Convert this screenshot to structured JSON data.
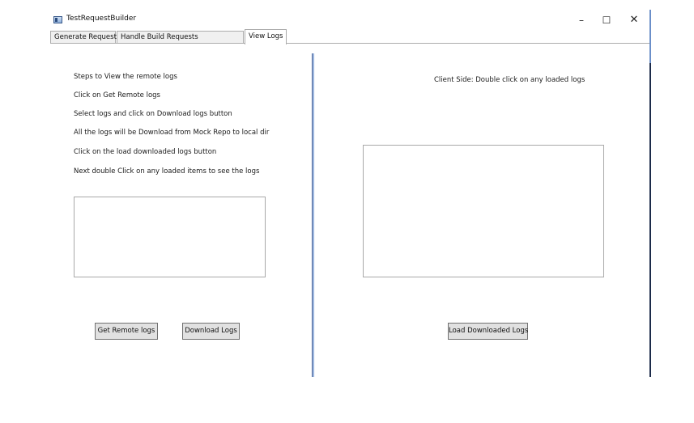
{
  "window": {
    "title": "TestRequestBuilder",
    "controls": {
      "minimize": "–",
      "maximize": "☐",
      "close": "✕"
    }
  },
  "tabs": [
    {
      "label": "Generate Requests",
      "selected": false
    },
    {
      "label": "Handle Build Requests",
      "selected": false
    },
    {
      "label": "View Logs",
      "selected": true
    }
  ],
  "left_panel": {
    "steps": [
      "Steps to View the remote logs",
      "Click on Get Remote logs",
      "Select logs and click on Download logs button",
      "All the logs will be  Download from Mock Repo to local dir",
      "Click on the load downloaded logs button",
      "Next double Click on any loaded items to see the logs"
    ],
    "buttons": {
      "get_remote": "Get Remote logs",
      "download": "Download Logs"
    }
  },
  "right_panel": {
    "label": "Client Side: Double click on any loaded logs",
    "buttons": {
      "load_downloaded": "Load Downloaded Logs"
    }
  },
  "colors": {
    "splitter": "#2f4f8f",
    "button_bg": "#e1e1e1",
    "tab_bg": "#f0f0f0"
  }
}
